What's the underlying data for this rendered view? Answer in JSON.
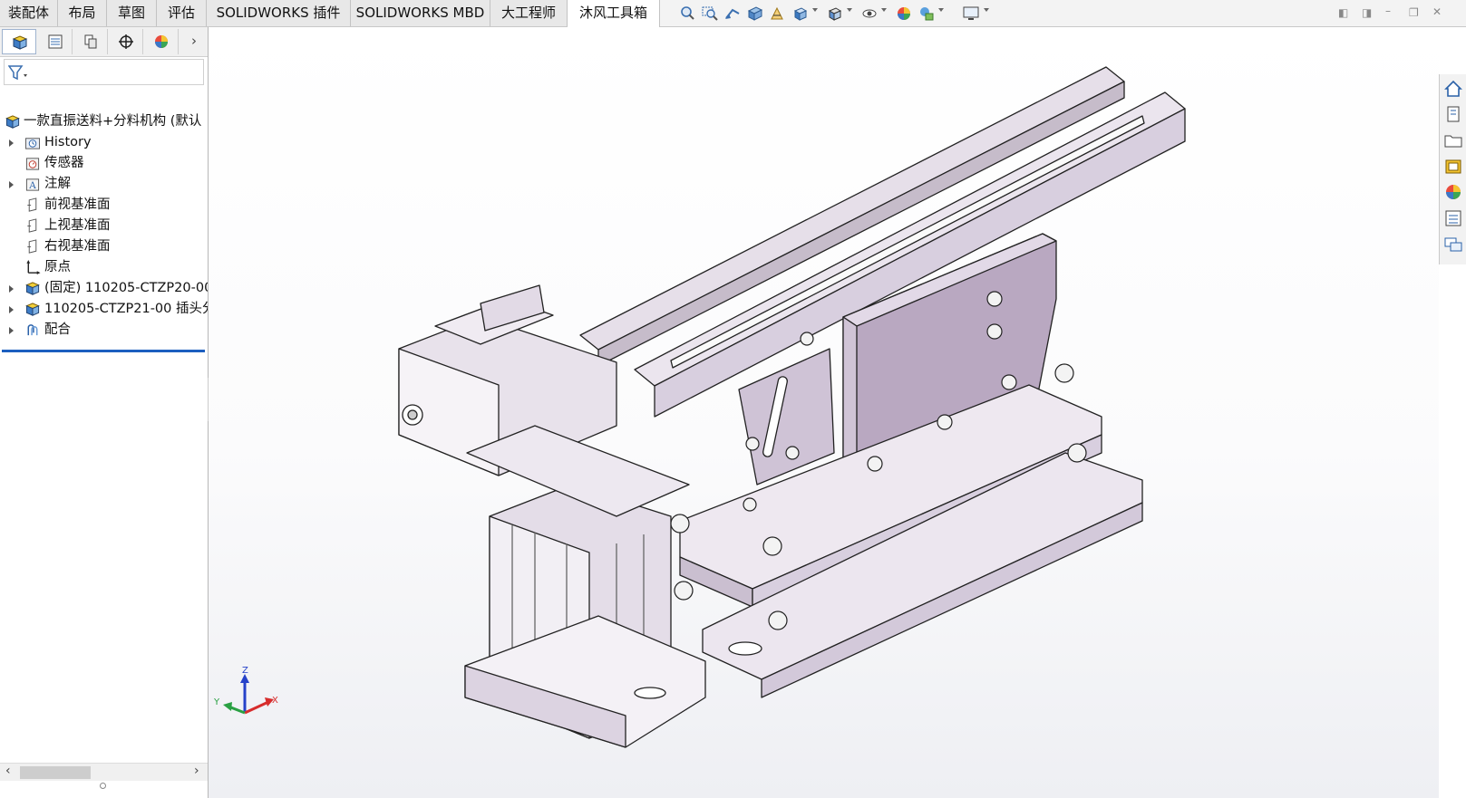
{
  "tabs": [
    {
      "label": "装配体",
      "active": false
    },
    {
      "label": "布局",
      "active": false
    },
    {
      "label": "草图",
      "active": false
    },
    {
      "label": "评估",
      "active": false
    },
    {
      "label": "SOLIDWORKS 插件",
      "active": false
    },
    {
      "label": "SOLIDWORKS MBD",
      "active": false
    },
    {
      "label": "大工程师",
      "active": false
    },
    {
      "label": "沐风工具箱",
      "active": true
    }
  ],
  "view_toolbar_icons": [
    "zoom-to-fit-icon",
    "zoom-area-icon",
    "previous-view-icon",
    "section-view-icon",
    "dynamic-annotation-icon",
    "view-orientation-icon",
    "display-style-icon",
    "hide-show-icon",
    "edit-appearance-icon",
    "apply-scene-icon",
    "view-settings-icon"
  ],
  "feature_tree": {
    "root": "一款直振送料+分料机构 (默认",
    "items": [
      {
        "label": "History",
        "expandable": true,
        "icon": "history-folder-icon"
      },
      {
        "label": "传感器",
        "expandable": false,
        "icon": "sensors-icon"
      },
      {
        "label": "注解",
        "expandable": true,
        "icon": "annotations-icon"
      },
      {
        "label": "前视基准面",
        "expandable": false,
        "icon": "plane-icon"
      },
      {
        "label": "上视基准面",
        "expandable": false,
        "icon": "plane-icon"
      },
      {
        "label": "右视基准面",
        "expandable": false,
        "icon": "plane-icon"
      },
      {
        "label": "原点",
        "expandable": false,
        "icon": "origin-icon"
      },
      {
        "label": "(固定) 110205-CTZP20-00",
        "expandable": true,
        "icon": "subassembly-icon"
      },
      {
        "label": "110205-CTZP21-00 插头分",
        "expandable": true,
        "icon": "subassembly-icon"
      },
      {
        "label": "配合",
        "expandable": true,
        "icon": "mates-icon"
      }
    ]
  },
  "triad": {
    "x": "X",
    "y": "Y",
    "z": "Z"
  },
  "colors": {
    "part_fill": "#d8cfdf",
    "part_edge": "#2a2a2a",
    "active_blue": "#1c5fbf"
  }
}
